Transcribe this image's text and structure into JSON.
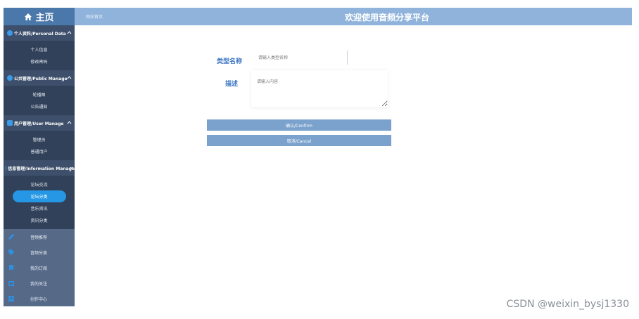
{
  "header": {
    "logo_label": "主页",
    "breadcrumb": "网站首页",
    "site_title": "欢迎使用音频分享平台"
  },
  "sidebar": {
    "groups": [
      {
        "label": "个人资料/Personal Data",
        "items": [
          "个人信息",
          "修改密码"
        ]
      },
      {
        "label": "公共管理/Public Manage",
        "items": [
          "轮播图",
          "公告通知"
        ]
      },
      {
        "label": "用户管理/User Manage",
        "items": [
          "管理员",
          "普通用户"
        ]
      },
      {
        "label": "信息管理/Information Manage",
        "items": [
          "论坛交流",
          "论坛分类",
          "音乐资讯",
          "资讯分类"
        ],
        "active_index": 1
      }
    ],
    "nav": [
      {
        "label": "音频推荐",
        "icon": "pencil-icon"
      },
      {
        "label": "音频分类",
        "icon": "tag-icon"
      },
      {
        "label": "我的订阅",
        "icon": "bookmark-icon"
      },
      {
        "label": "我的关注",
        "icon": "calendar-icon"
      },
      {
        "label": "创作中心",
        "icon": "grid-icon"
      }
    ]
  },
  "form": {
    "type_label": "类型名称",
    "type_placeholder": "请输入类型名称",
    "desc_label": "描述",
    "desc_placeholder": "请输入内容",
    "confirm_label": "确认/Confirm",
    "cancel_label": "取消/Cancel"
  },
  "watermark": "CSDN @weixin_bysj1330",
  "colors": {
    "header_bg": "#8fb3db",
    "logo_bg": "#4b78aa",
    "sidebar_bg": "#4a5e7b",
    "active_pill": "#2597e4",
    "button_bg": "#7aa2cc",
    "label_color": "#3b74c4"
  }
}
